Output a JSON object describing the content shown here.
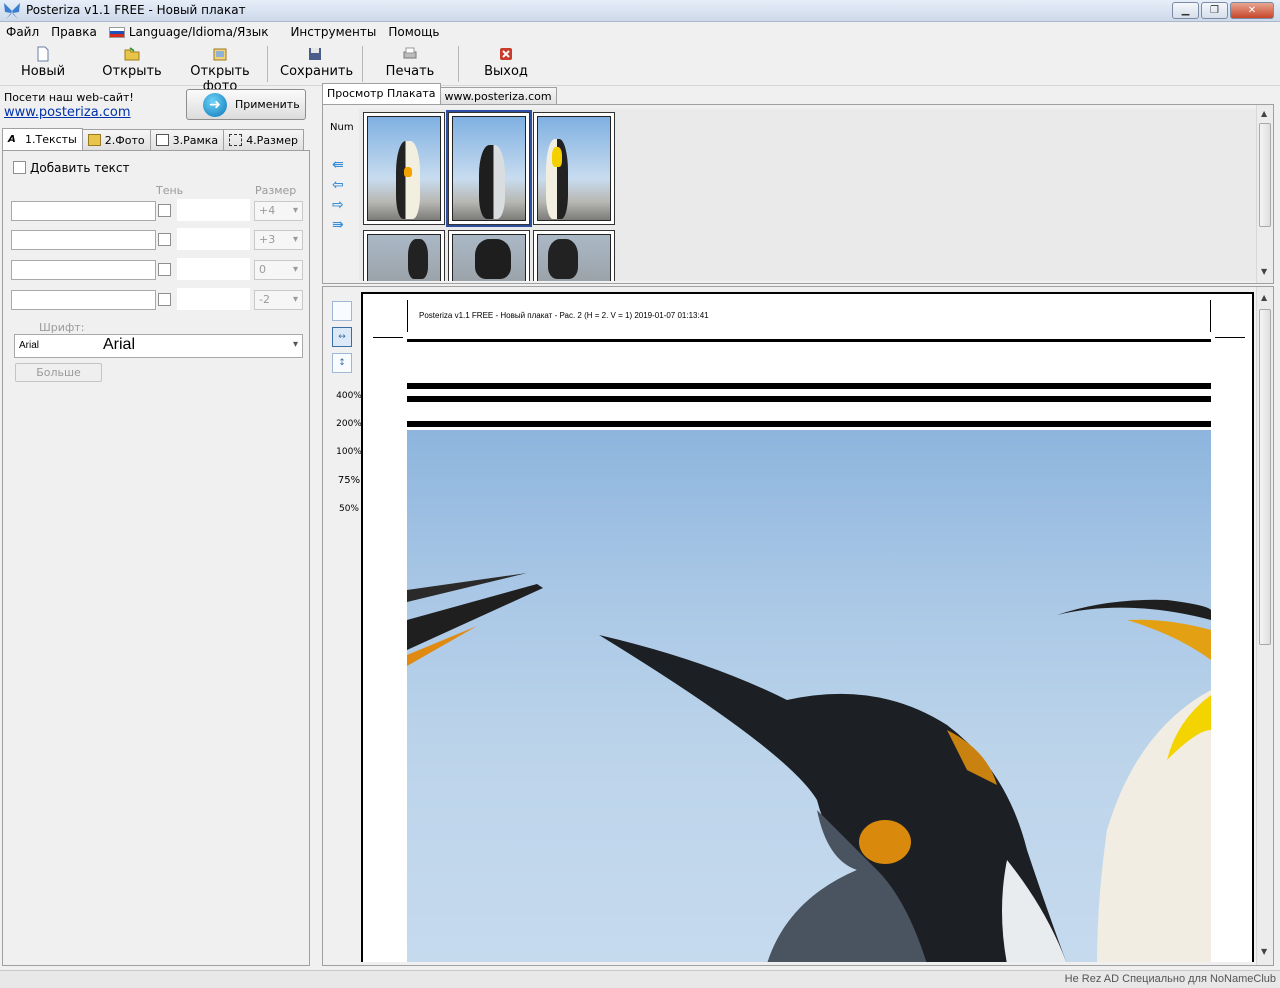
{
  "window": {
    "title": "Posteriza v1.1 FREE - Новый плакат",
    "controls": [
      "▁",
      "❐",
      "✕"
    ]
  },
  "menu": [
    "Файл",
    "Правка",
    "Language/Idioma/Язык",
    "Инструменты",
    "Помощь"
  ],
  "toolbar": {
    "new": "Новый",
    "open": "Открыть",
    "open_photo": "Открыть фото",
    "save": "Сохранить",
    "print": "Печать",
    "exit": "Выход"
  },
  "left": {
    "visit_label": "Посети наш web-сайт!",
    "site_link": "www.posteriza.com",
    "apply": "Применить",
    "tabs": [
      "1.Тексты",
      "2.Фото",
      "3.Рамка",
      "4.Размер"
    ],
    "add_text": "Добавить текст",
    "col_shadow": "Тень",
    "col_size": "Размер",
    "rows": [
      {
        "text": "",
        "size": "+4"
      },
      {
        "text": "",
        "size": "+3"
      },
      {
        "text": "",
        "size": "0"
      },
      {
        "text": "",
        "size": "-2"
      }
    ],
    "font_label": "Шрифт:",
    "font_name_small": "Arial",
    "font_name_big": "Arial",
    "more": "Больше"
  },
  "right": {
    "tabs": [
      "Просмотр Плаката",
      "www.posteriza.com"
    ],
    "num_label": "Num",
    "nav_icons": [
      "first-page-icon",
      "prev-page-icon",
      "next-page-icon",
      "last-page-icon"
    ],
    "zoom_levels": [
      "400%",
      "200%",
      "100%",
      "75%",
      "50%"
    ],
    "page_header": "Posteriza v1.1 FREE - Новый плакат - Рас. 2 (H = 2. V = 1) 2019-01-07  01:13:41"
  },
  "status": "Не Rez AD Специально для NoNameClub",
  "colors": {
    "selection": "#2c4fa3",
    "link": "#0033aa",
    "sky": "#a9c7e6"
  }
}
